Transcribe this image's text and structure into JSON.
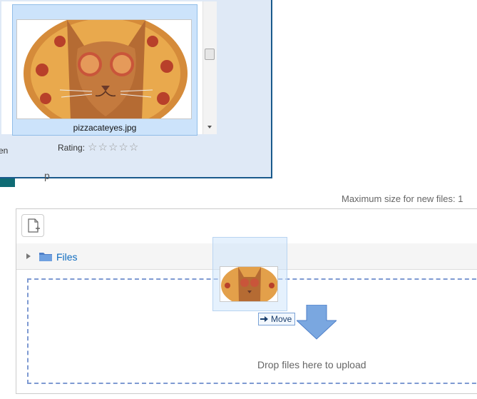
{
  "explorer": {
    "file_name": "pizzacateyes.jpg",
    "details_fragment": "en",
    "rating_label": "Rating:",
    "rating_value": 0,
    "stars": [
      "☆",
      "☆",
      "☆",
      "☆",
      "☆"
    ]
  },
  "behind": {
    "text_fragment": "p"
  },
  "filemanager": {
    "max_size_label": "Maximum size for new files: 1",
    "folder_label": "Files",
    "drop_text": "Drop files here to upload",
    "move_label": "Move"
  },
  "icons": {
    "add_file": "add-file-icon",
    "folder": "folder-icon",
    "toggle": "tree-toggle-icon",
    "move": "move-arrow-icon",
    "drop_arrow": "drop-arrow-icon"
  },
  "colors": {
    "link": "#0f6cbf",
    "dropzone_border": "#7e9ad2",
    "selection": "#cce3fb",
    "explorer_frame": "#1a5a8c"
  }
}
